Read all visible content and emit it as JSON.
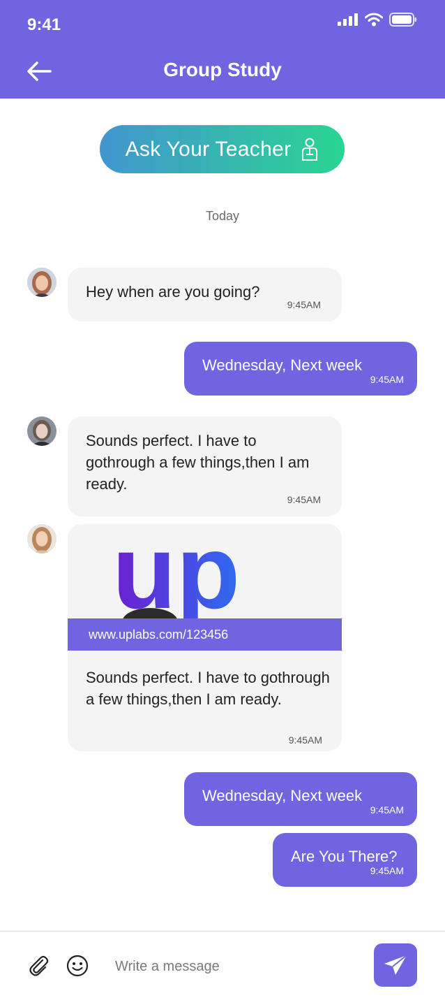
{
  "status_bar": {
    "time": "9:41"
  },
  "header": {
    "title": "Group Study"
  },
  "ask_teacher": {
    "label": "Ask Your Teacher"
  },
  "date_divider": "Today",
  "messages": [
    {
      "direction": "incoming",
      "text": "Hey when are you going?",
      "time": "9:45AM"
    },
    {
      "direction": "outgoing",
      "text": "Wednesday, Next week",
      "time": "9:45AM"
    },
    {
      "direction": "incoming",
      "text": "Sounds perfect. I have to gothrough a few things,then I am ready.",
      "time": "9:45AM"
    },
    {
      "direction": "incoming",
      "link_preview": {
        "logo_text": "up",
        "url": "www.uplabs.com/123456"
      },
      "text": "Sounds perfect. I have to gothrough a few things,then I am ready.",
      "time": "9:45AM"
    },
    {
      "direction": "outgoing",
      "text": "Wednesday, Next week",
      "time": "9:45AM"
    },
    {
      "direction": "outgoing",
      "text": "Are You There?",
      "time": "9:45AM"
    }
  ],
  "composer": {
    "placeholder": "Write a message"
  },
  "colors": {
    "primary": "#7164e0",
    "gradient_start": "#4295cf",
    "gradient_end": "#2bd592"
  },
  "icons": [
    "back-arrow-icon",
    "signal-icon",
    "wifi-icon",
    "battery-icon",
    "teacher-icon",
    "paperclip-icon",
    "emoji-icon",
    "send-icon"
  ]
}
